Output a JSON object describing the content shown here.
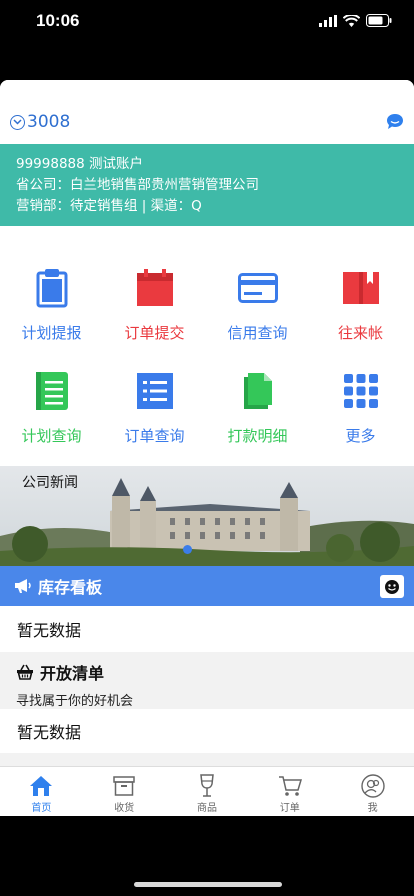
{
  "status": {
    "time": "10:06"
  },
  "header": {
    "account_id": "3008"
  },
  "info": {
    "line1": "99998888 测试账户",
    "line2": "省公司：白兰地销售部贵州营销管理公司",
    "line3": "营销部：待定销售组 | 渠道：Q"
  },
  "grid": [
    {
      "label": "计划提报",
      "icon": "clipboard-icon",
      "color": "#3a7bea"
    },
    {
      "label": "订单提交",
      "icon": "calendar-icon",
      "color": "#ea3a3f"
    },
    {
      "label": "信用查询",
      "icon": "credit-card-icon",
      "color": "#3a7bea"
    },
    {
      "label": "往来帐",
      "icon": "ledger-book-icon",
      "color": "#ea3a3f"
    },
    {
      "label": "计划查询",
      "icon": "notebook-icon",
      "color": "#34c759"
    },
    {
      "label": "订单查询",
      "icon": "list-icon",
      "color": "#3a7bea"
    },
    {
      "label": "打款明细",
      "icon": "documents-icon",
      "color": "#34c759"
    },
    {
      "label": "更多",
      "icon": "grid-dots-icon",
      "color": "#3a7bea"
    }
  ],
  "news": {
    "title": "公司新闻"
  },
  "stock": {
    "title": "库存看板",
    "empty": "暂无数据"
  },
  "open_list": {
    "title": "开放清单",
    "subtitle": "寻找属于你的好机会",
    "empty": "暂无数据"
  },
  "tabs": [
    {
      "label": "首页",
      "icon": "home-icon",
      "active": true
    },
    {
      "label": "收货",
      "icon": "box-icon",
      "active": false
    },
    {
      "label": "商品",
      "icon": "wine-glass-icon",
      "active": false
    },
    {
      "label": "订单",
      "icon": "cart-icon",
      "active": false
    },
    {
      "label": "我",
      "icon": "user-icon",
      "active": false
    }
  ]
}
